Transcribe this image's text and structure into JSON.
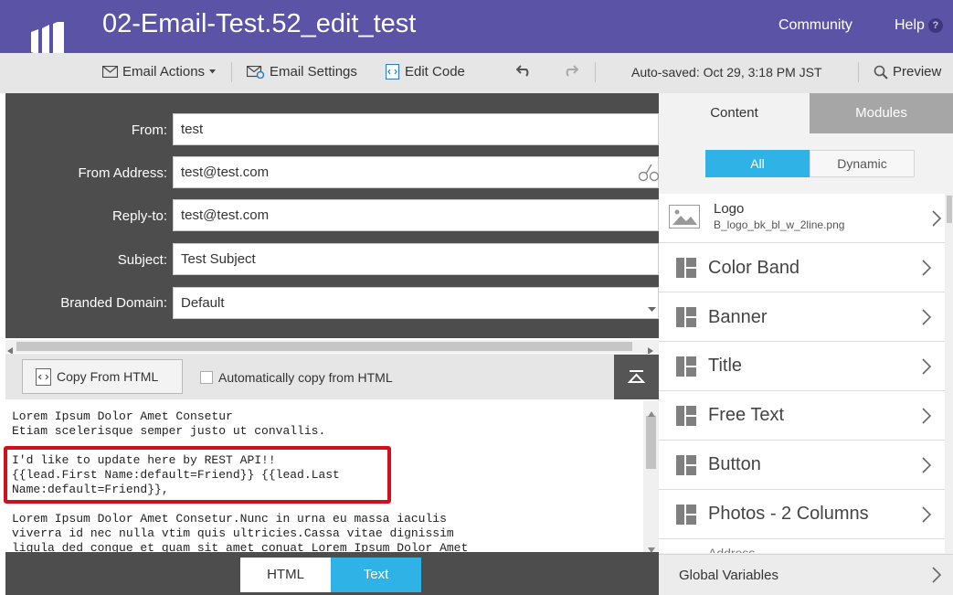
{
  "header": {
    "title": "02-Email-Test.52_edit_test",
    "community_label": "Community",
    "help_label": "Help",
    "help_icon": "?"
  },
  "toolbar": {
    "email_actions_label": "Email Actions",
    "email_settings_label": "Email Settings",
    "edit_code_label": "Edit Code",
    "autosave_text": "Auto-saved: Oct 29, 3:18 PM JST",
    "preview_label": "Preview"
  },
  "form": {
    "from_label": "From:",
    "from_value": "test",
    "from_address_label": "From Address:",
    "from_address_value": "test@test.com",
    "reply_to_label": "Reply-to:",
    "reply_to_value": "test@test.com",
    "subject_label": "Subject:",
    "subject_value": "Test Subject",
    "branded_domain_label": "Branded Domain:",
    "branded_domain_value": "Default"
  },
  "editor": {
    "copy_button_label": "Copy From HTML",
    "auto_copy_label": "Automatically copy from HTML",
    "auto_copy_checked": false,
    "lines": [
      "Lorem Ipsum Dolor Amet Consetur",
      "Etiam scelerisque semper justo ut convallis.",
      "",
      "I'd like to update here by REST API!!",
      "{{lead.First Name:default=Friend}} {{lead.Last",
      "Name:default=Friend}},",
      "",
      "Lorem Ipsum Dolor Amet Consetur.Nunc in urna eu massa iaculis",
      "viverra id nec nulla vtim quis ultricies.Cassa vitae dignissim",
      "ligula ded congue et quam sit amet conuat Lorem Ipsum Dolor Amet"
    ]
  },
  "bottom_tabs": {
    "html_label": "HTML",
    "text_label": "Text",
    "active": "Text"
  },
  "right_panel": {
    "tab_content": "Content",
    "tab_modules": "Modules",
    "filter_all": "All",
    "filter_dynamic": "Dynamic",
    "logo_title": "Logo",
    "logo_file": "B_logo_bk_bl_w_2line.png",
    "modules": [
      "Color Band",
      "Banner",
      "Title",
      "Free Text",
      "Button",
      "Photos - 2 Columns"
    ],
    "partial_module": "Address",
    "global_variables_label": "Global Variables"
  },
  "colors": {
    "header_purple": "#5b53a5",
    "accent_blue": "#2fb3e6",
    "highlight_red": "#d0101a",
    "dark_panel": "#4d4d4d"
  }
}
